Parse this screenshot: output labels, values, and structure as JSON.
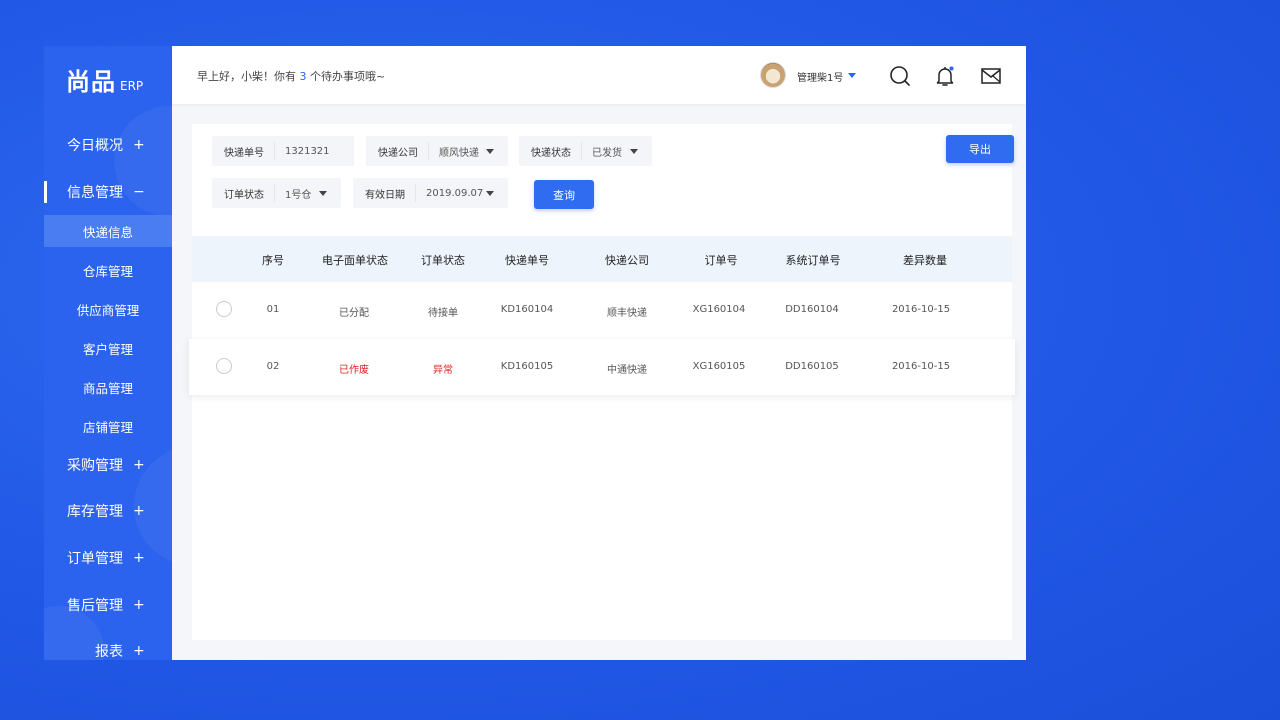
{
  "logo": {
    "brand": "尚品",
    "suffix": "ERP"
  },
  "sidebar": {
    "items": [
      {
        "label": "今日概况",
        "icon": "+"
      },
      {
        "label": "信息管理",
        "icon": "−"
      },
      {
        "label": "采购管理",
        "icon": "+"
      },
      {
        "label": "库存管理",
        "icon": "+"
      },
      {
        "label": "订单管理",
        "icon": "+"
      },
      {
        "label": "售后管理",
        "icon": "+"
      },
      {
        "label": "报表",
        "icon": "+"
      }
    ],
    "sub_items": [
      "快递信息",
      "仓库管理",
      "供应商管理",
      "客户管理",
      "商品管理",
      "店铺管理"
    ]
  },
  "header": {
    "greeting_before": "早上好，小柴！你有 ",
    "todo_count": "3",
    "greeting_after": " 个待办事项哦~",
    "user_name": "管理柴1号"
  },
  "filters": {
    "express_no": {
      "label": "快递单号",
      "value": "1321321"
    },
    "express_company": {
      "label": "快递公司",
      "value": "顺风快递"
    },
    "express_status": {
      "label": "快递状态",
      "value": "已发货"
    },
    "order_status": {
      "label": "订单状态",
      "value": "1号仓"
    },
    "valid_date": {
      "label": "有效日期",
      "value": "2019.09.07"
    },
    "query_button": "查询",
    "export_button": "导出"
  },
  "table": {
    "headers": [
      "序号",
      "电子面单状态",
      "订单状态",
      "快递单号",
      "快递公司",
      "订单号",
      "系统订单号",
      "差异数量"
    ],
    "rows": [
      [
        "01",
        "已分配",
        "待接单",
        "KD160104",
        "顺丰快递",
        "XG160104",
        "DD160104",
        "2016-10-15"
      ],
      [
        "02",
        "已作废",
        "异常",
        "KD160105",
        "中通快递",
        "XG160105",
        "DD160105",
        "2016-10-15"
      ]
    ]
  },
  "colors": {
    "primary": "#2b62ee",
    "danger": "#e02020",
    "header_row": "#eef4fc"
  }
}
